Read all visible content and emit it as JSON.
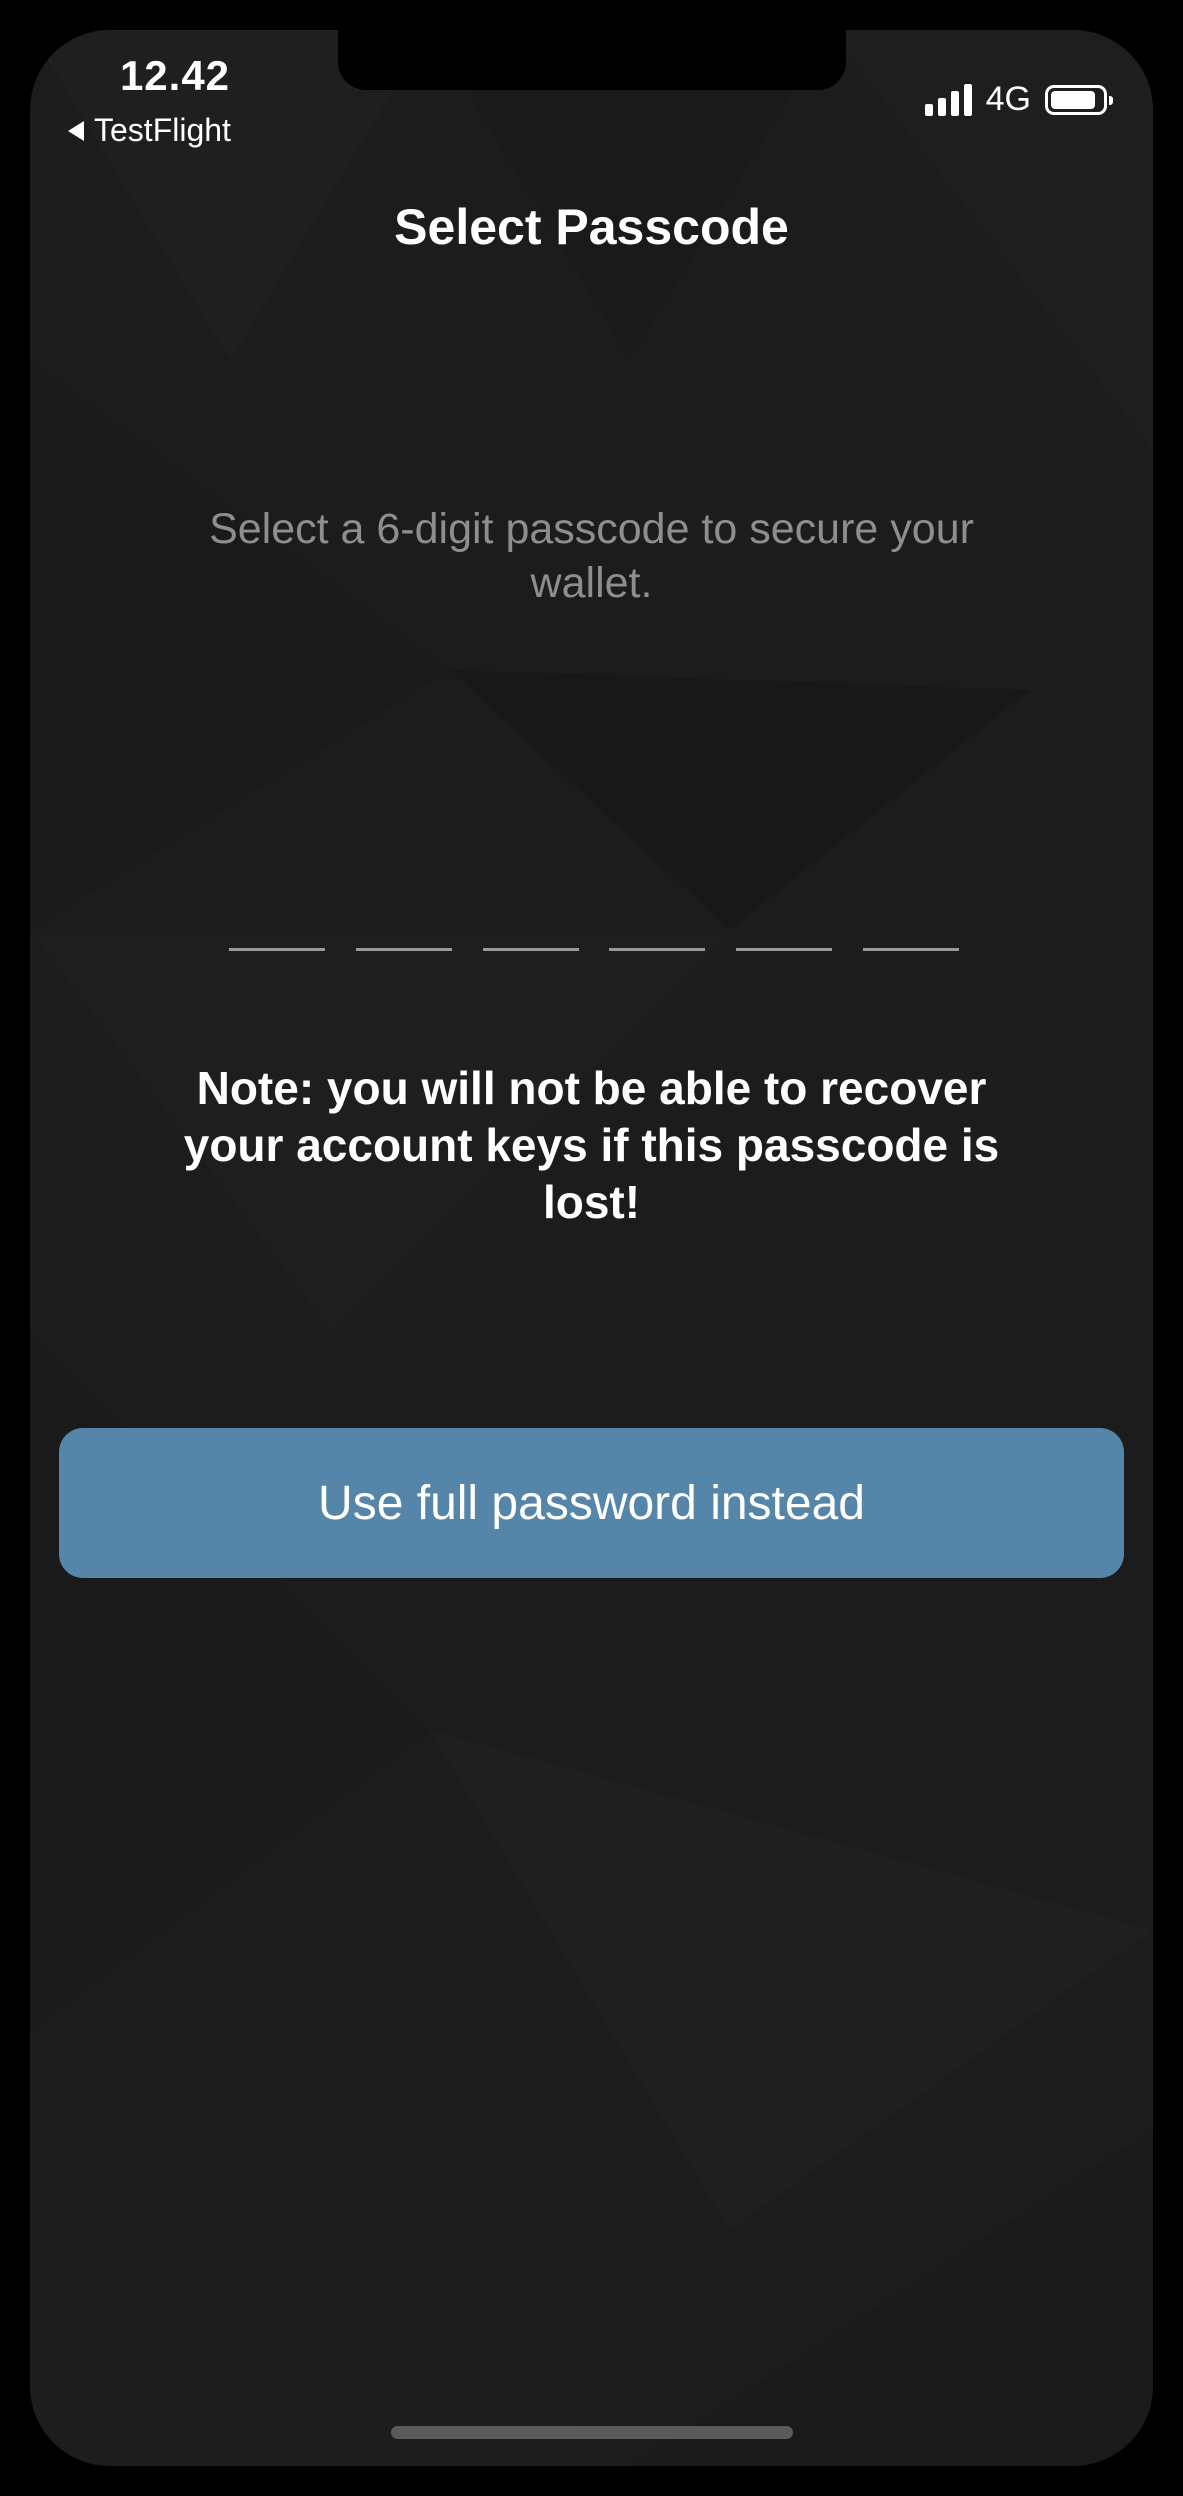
{
  "status_bar": {
    "time": "12.42",
    "back_app": "TestFlight",
    "network": "4G"
  },
  "header": {
    "title": "Select Passcode"
  },
  "main": {
    "instruction": "Select a 6-digit passcode to secure your wallet.",
    "passcode_slots": [
      "",
      "",
      "",
      "",
      "",
      ""
    ],
    "warning": "Note: you will not be able to recover your account keys if this passcode is lost!",
    "full_password_button_label": "Use full password instead"
  },
  "colors": {
    "background": "#1c1c1c",
    "button": "#5585a8",
    "instruction_text": "#8e8e8e"
  }
}
